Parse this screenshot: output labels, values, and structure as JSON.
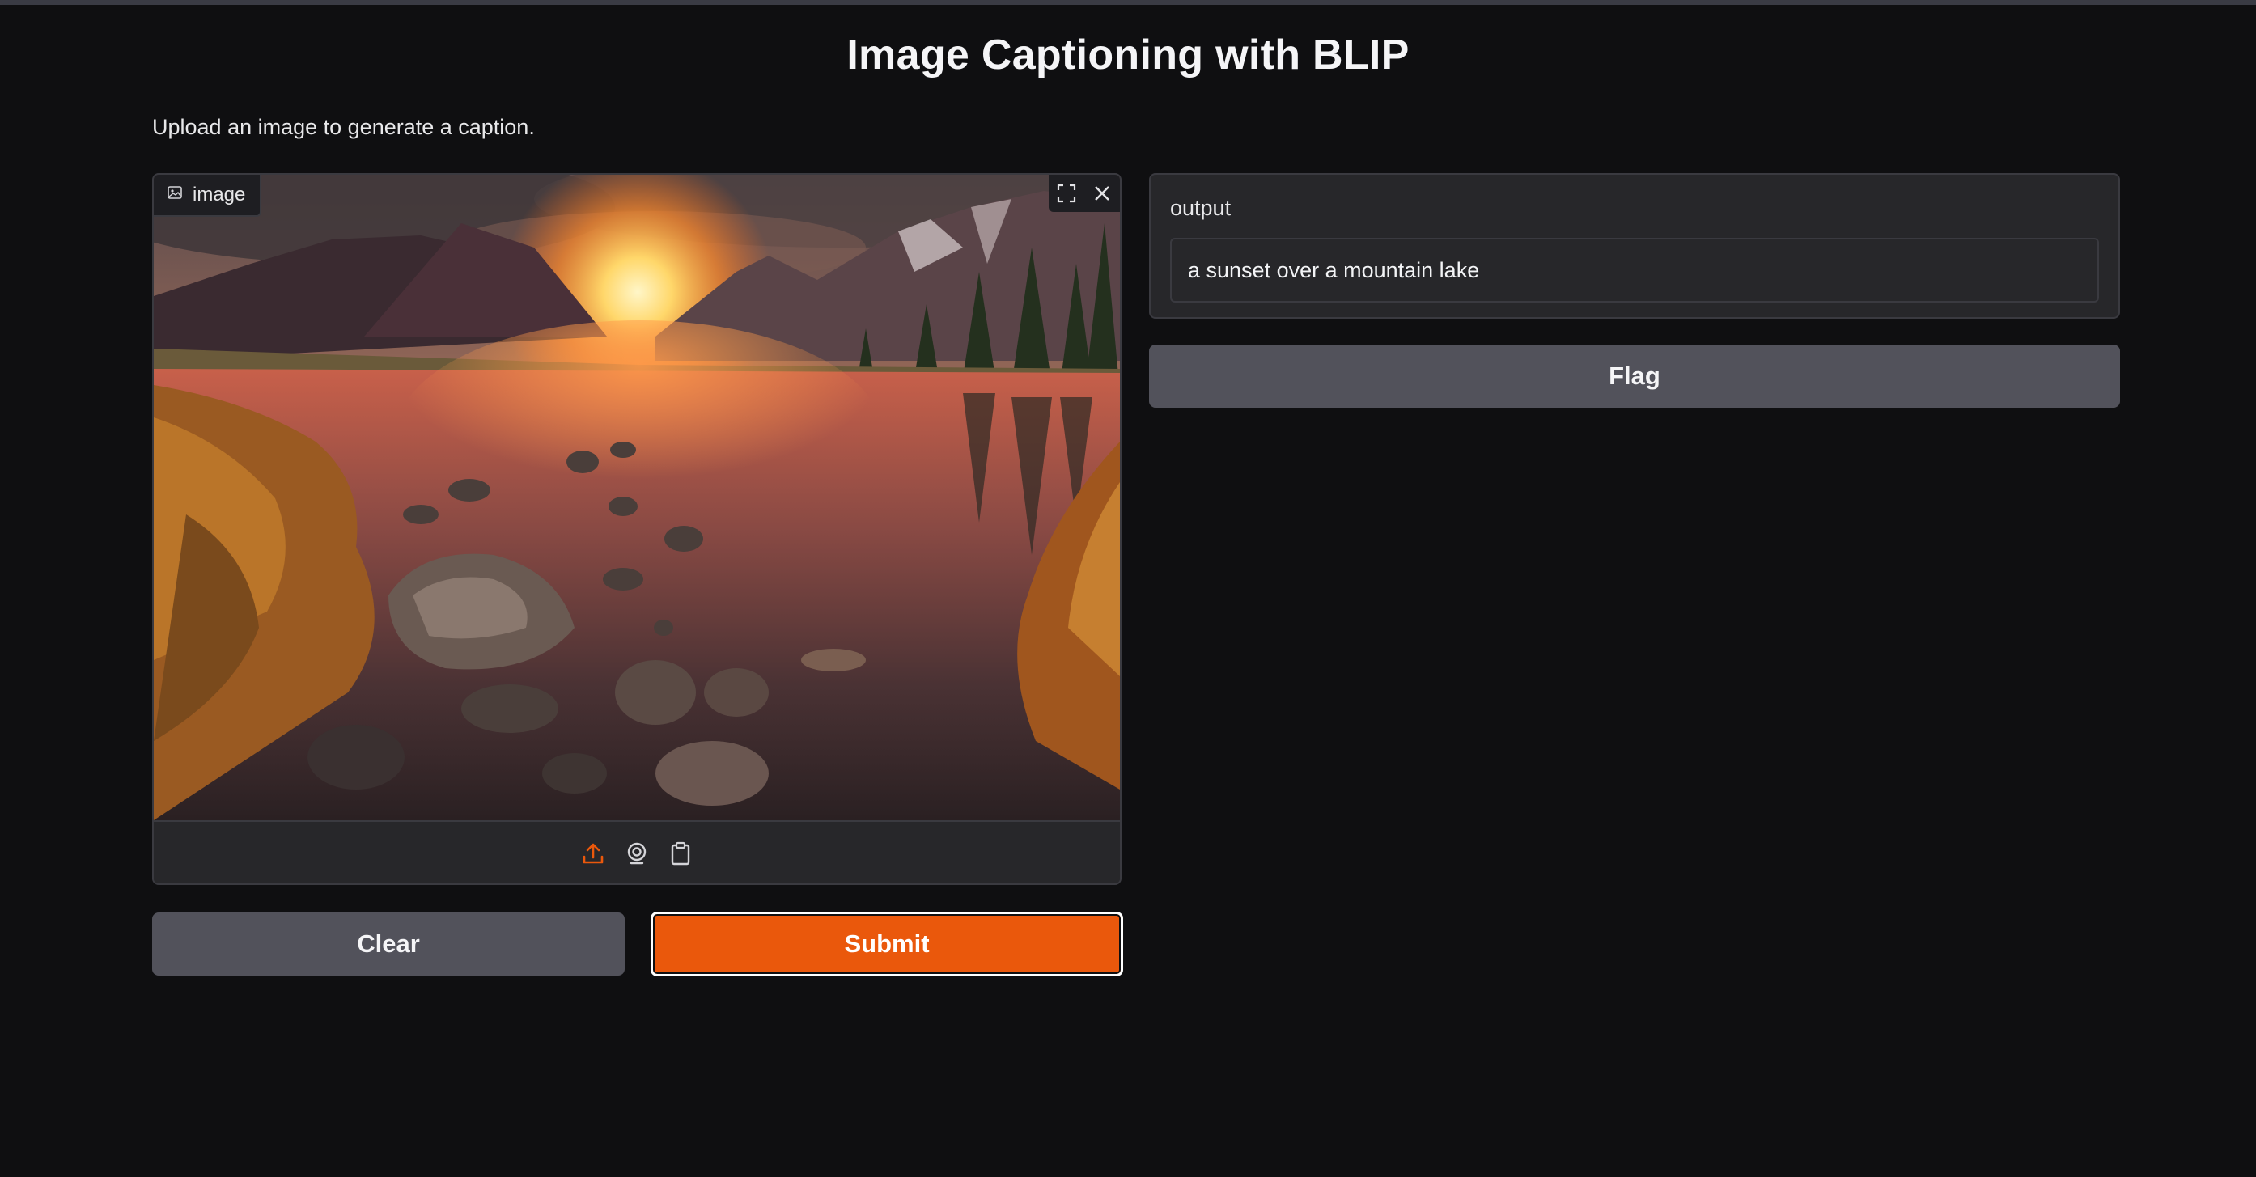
{
  "app": {
    "title": "Image Captioning with BLIP",
    "description": "Upload an image to generate a caption."
  },
  "image_input": {
    "label": "image",
    "has_image": true,
    "image_content": "sunset over mountain lake with rocks and autumn grass",
    "actions": [
      "fullscreen-icon",
      "close-icon"
    ],
    "sources": [
      "upload-icon",
      "webcam-icon",
      "clipboard-icon"
    ],
    "active_source_color": "#ea580c"
  },
  "buttons": {
    "clear_label": "Clear",
    "submit_label": "Submit",
    "flag_label": "Flag"
  },
  "output": {
    "label": "output",
    "value": "a sunset over a mountain lake"
  },
  "colors": {
    "background": "#0f0f11",
    "panel": "#27272a",
    "secondary_button": "#52525b",
    "primary_button": "#ea580c"
  }
}
